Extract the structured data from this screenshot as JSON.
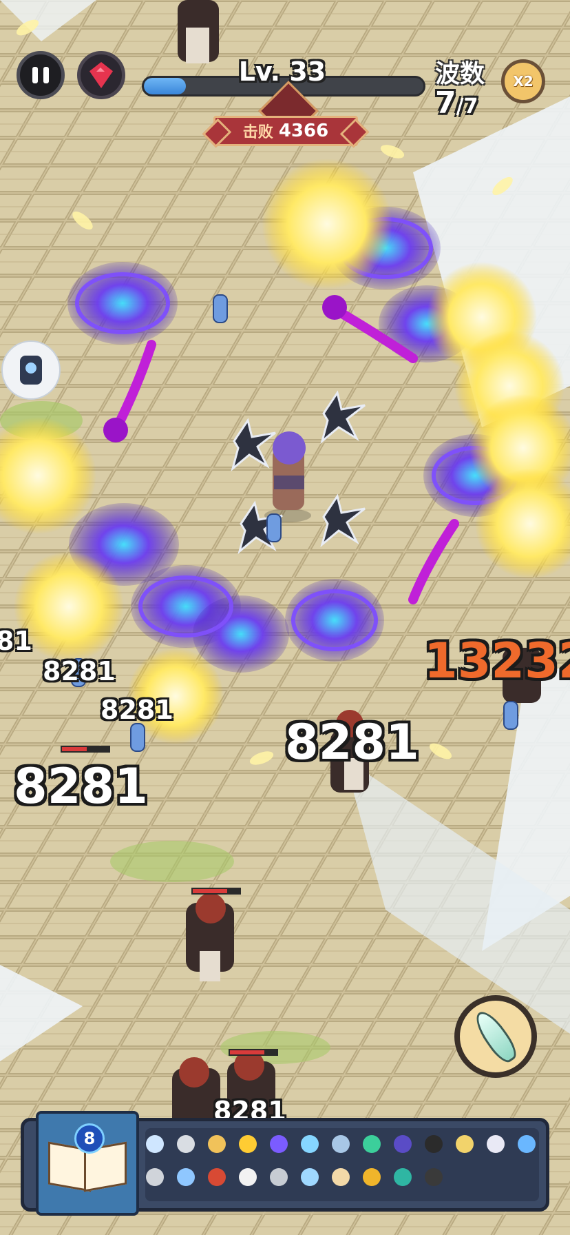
{
  "hud": {
    "level_text": "Lv. 33",
    "xp_progress": 0.15,
    "kill_label": "击败",
    "kill_count": "4366",
    "wave_label": "波数",
    "wave_current": "7",
    "wave_total": "/7",
    "speed_label": "X2"
  },
  "damage_numbers": [
    {
      "text": "81"
    },
    {
      "text": "8281"
    },
    {
      "text": "8281"
    },
    {
      "text": "8281"
    },
    {
      "text": "8281"
    },
    {
      "text": "13232"
    },
    {
      "text": "8281"
    }
  ],
  "inventory": {
    "book_level": "8",
    "row1_items": [
      {
        "icon": "potion-icon",
        "color": "#cfe6ff"
      },
      {
        "icon": "sword-icon",
        "color": "#d9dde3"
      },
      {
        "icon": "scroll-icon",
        "color": "#f1c25a"
      },
      {
        "icon": "star-icon",
        "color": "#ffcc33"
      },
      {
        "icon": "crescent-icon",
        "color": "#7b5cff"
      },
      {
        "icon": "crystal-icon",
        "color": "#86d6ff"
      },
      {
        "icon": "pouch-icon",
        "color": "#a8c7e6"
      },
      {
        "icon": "gem-icon",
        "color": "#3ccf9b"
      },
      {
        "icon": "orb-icon",
        "color": "#5a4cc6"
      },
      {
        "icon": "ring-icon",
        "color": "#2b2b2b"
      },
      {
        "icon": "wings-icon",
        "color": "#f2d36b"
      },
      {
        "icon": "dagger-icon",
        "color": "#e9e9f5"
      },
      {
        "icon": "shield-icon",
        "color": "#6ab7ff"
      }
    ],
    "row2_items": [
      {
        "icon": "gears-icon",
        "color": "#d0d4da"
      },
      {
        "icon": "flask-icon",
        "color": "#8fc7ff"
      },
      {
        "icon": "bowl-icon",
        "color": "#d84a34"
      },
      {
        "icon": "bell-icon",
        "color": "#f2f2f2"
      },
      {
        "icon": "boot-icon",
        "color": "#c7ccd3"
      },
      {
        "icon": "trident-icon",
        "color": "#9fd8ff"
      },
      {
        "icon": "necklace-icon",
        "color": "#f3d9a8"
      },
      {
        "icon": "helmet-icon",
        "color": "#f0b52b"
      },
      {
        "icon": "tome-icon",
        "color": "#2fb6a3"
      },
      {
        "icon": "wheel-icon",
        "color": "#3a3a3a"
      }
    ]
  }
}
